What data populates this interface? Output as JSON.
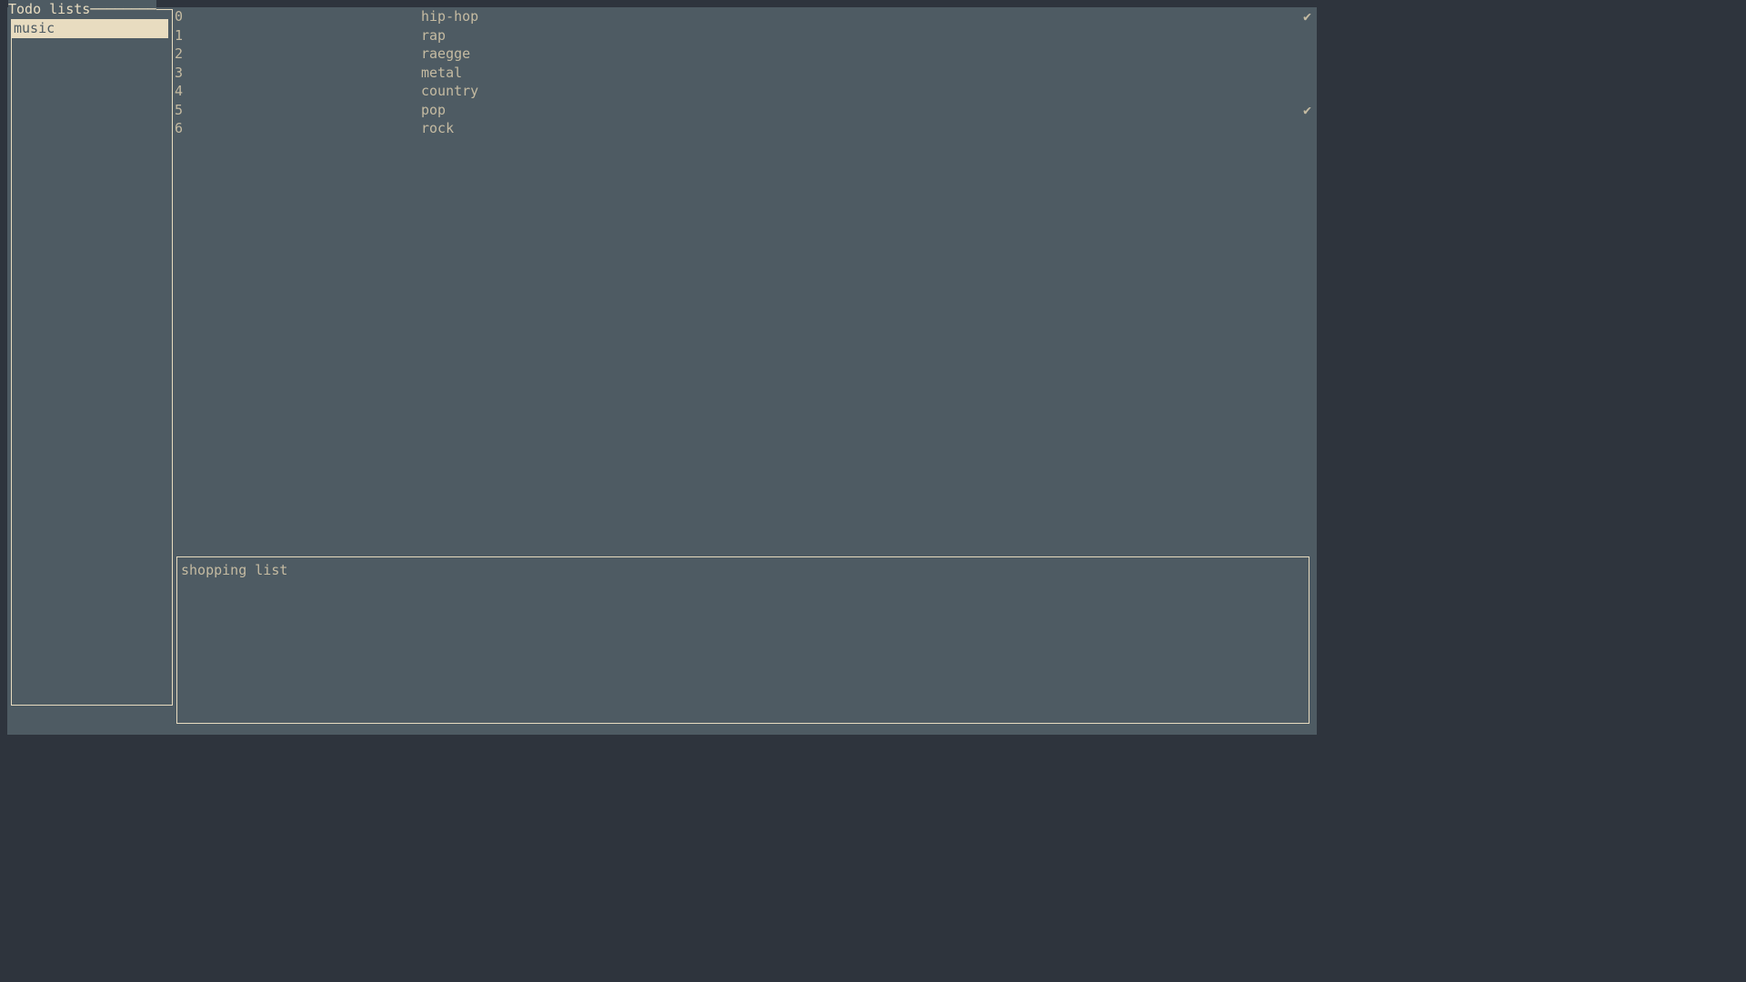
{
  "sidebar": {
    "title": "Todo lists────────",
    "items": [
      {
        "label": "music",
        "selected": true
      }
    ]
  },
  "tasks": [
    {
      "index": "0",
      "label": "hip-hop",
      "done": true
    },
    {
      "index": "1",
      "label": "rap",
      "done": false
    },
    {
      "index": "2",
      "label": "raegge",
      "done": false
    },
    {
      "index": "3",
      "label": "metal",
      "done": false
    },
    {
      "index": "4",
      "label": "country",
      "done": false
    },
    {
      "index": "5",
      "label": "pop",
      "done": true
    },
    {
      "index": "6",
      "label": "rock",
      "done": false
    }
  ],
  "input": {
    "value": "shopping list"
  },
  "glyphs": {
    "check": "✔"
  }
}
